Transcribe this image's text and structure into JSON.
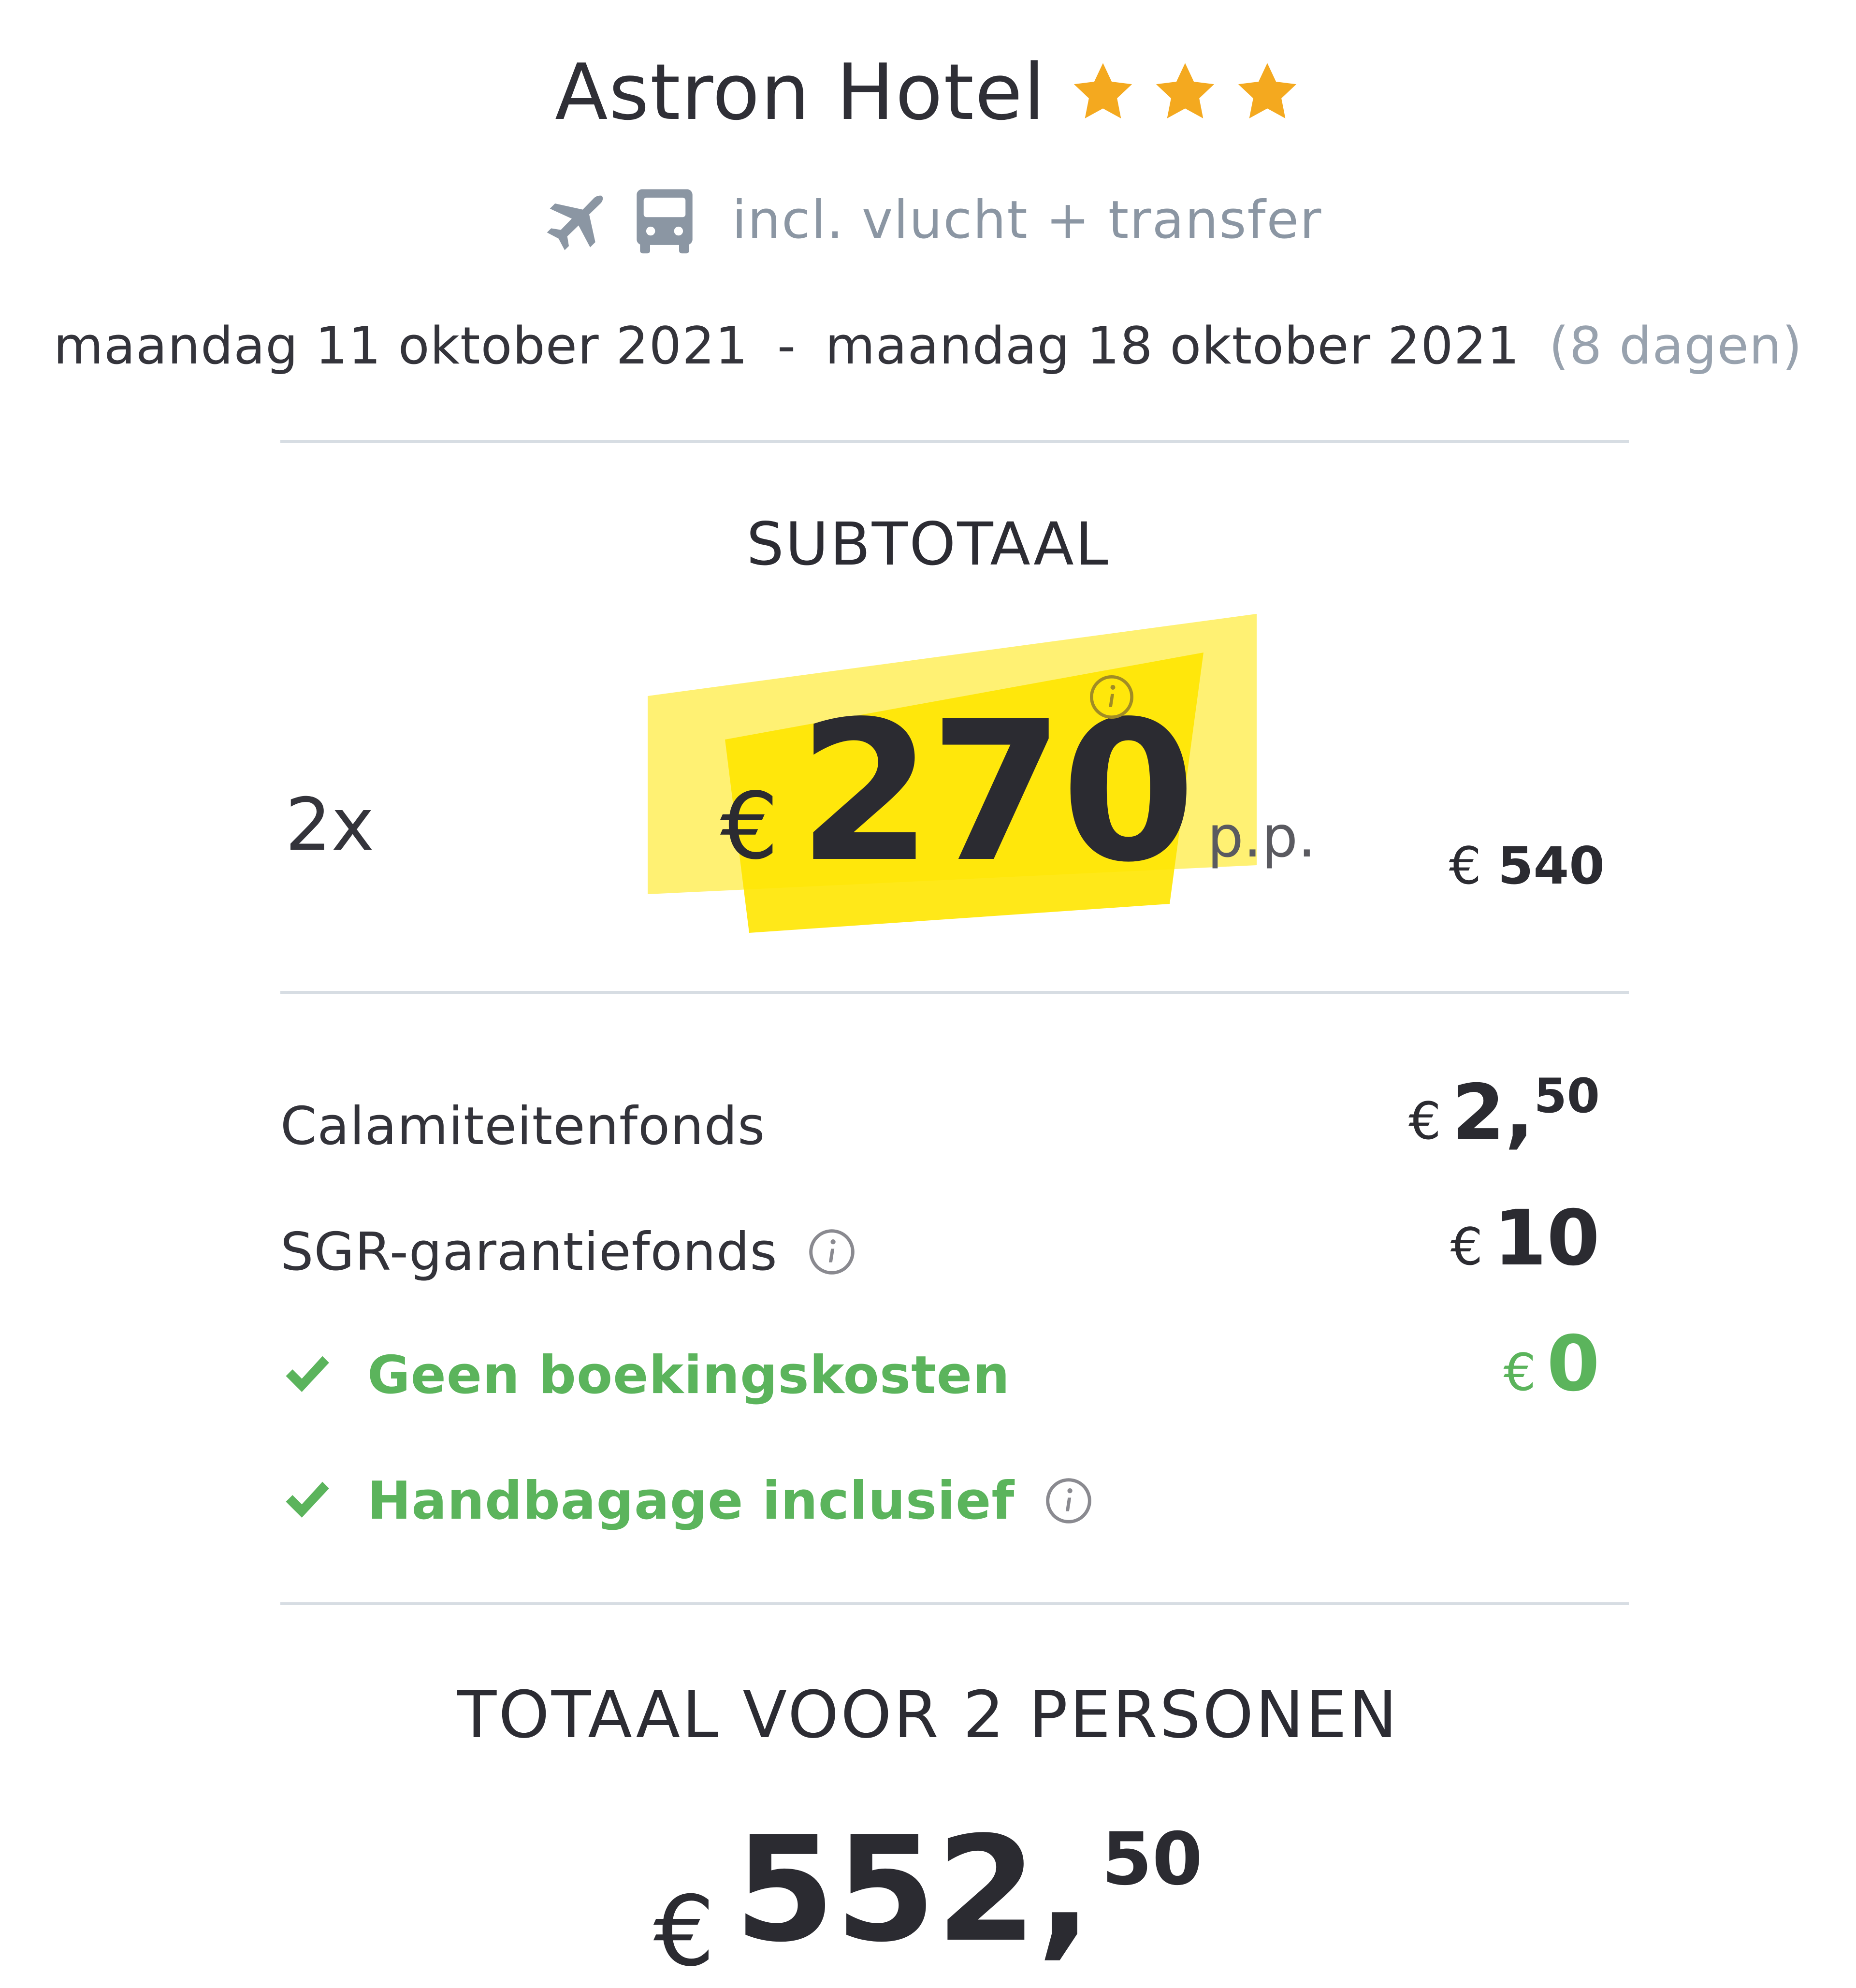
{
  "hotel": {
    "name": "Astron Hotel",
    "stars": 3
  },
  "transport": {
    "label": "incl. vlucht + transfer",
    "icons": [
      "airplane-icon",
      "bus-icon"
    ]
  },
  "dates": {
    "start": "maandag 11 oktober 2021",
    "separator": "-",
    "end": "maandag 18 oktober 2021",
    "duration": "(8 dagen)"
  },
  "subtotal": {
    "title": "SUBTOTAAL",
    "quantity": "2x",
    "currency": "€",
    "price_per_person": "270",
    "per_person_label": "p.p.",
    "total_currency": "€",
    "total": "540"
  },
  "fees": [
    {
      "label": "Calamiteitenfonds",
      "currency": "€",
      "int": "2,",
      "dec": "50"
    },
    {
      "label": "SGR-garantiefonds",
      "currency": "€",
      "int": "10",
      "dec": ""
    },
    {
      "label": "Geen boekingskosten",
      "currency": "€",
      "int": "0",
      "dec": ""
    },
    {
      "label": "Handbagage inclusief"
    }
  ],
  "total": {
    "title": "TOTAAL VOOR 2 PERSONEN",
    "currency": "€",
    "int": "552,",
    "dec": "50"
  },
  "colors": {
    "star": "#f4a91f",
    "highlight": "#ffe600",
    "green": "#5bb45c",
    "muted": "#8b96a3",
    "text": "#2b2b31"
  }
}
